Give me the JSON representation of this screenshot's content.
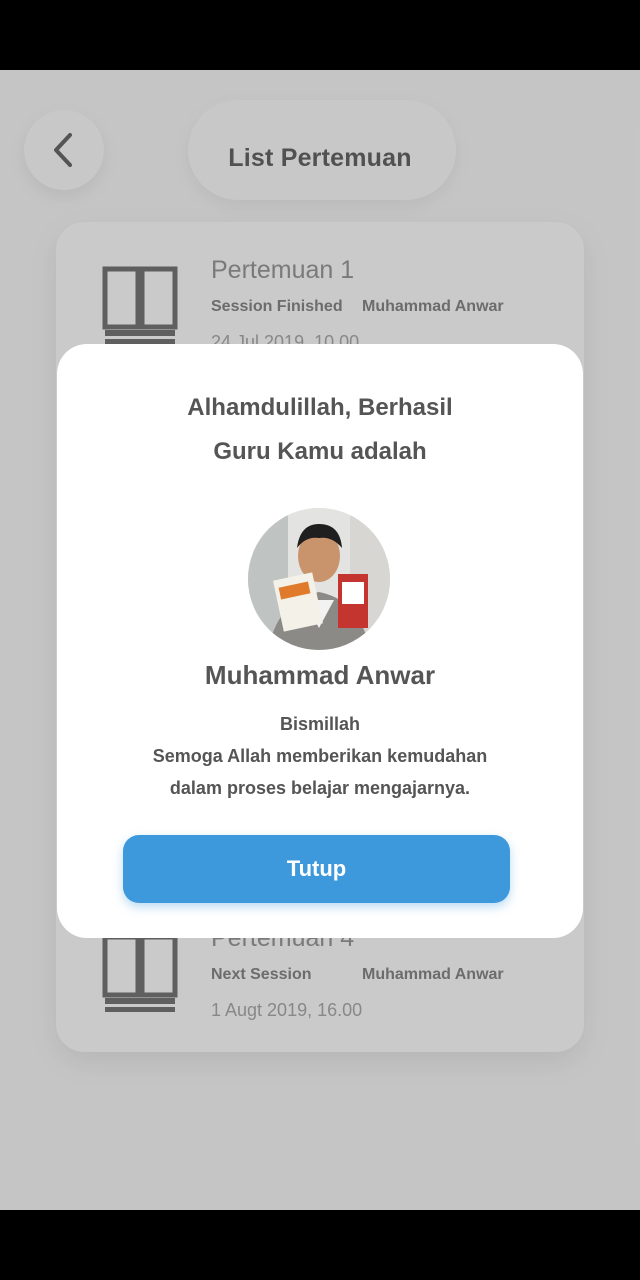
{
  "header": {
    "title": "List Pertemuan"
  },
  "meetings": [
    {
      "title": "Pertemuan 1",
      "status": "Session Finished",
      "teacher": "Muhammad Anwar",
      "date": "24 Jul 2019, 10.00"
    },
    {
      "title": "Pertemuan 4",
      "status": "Next Session",
      "teacher": "Muhammad Anwar",
      "date": "1 Augt 2019, 16.00"
    }
  ],
  "dialog": {
    "line1": "Alhamdulillah, Berhasil",
    "line2": "Guru Kamu adalah",
    "teacher_name": "Muhammad Anwar",
    "message_line1": "Bismillah",
    "message_line2": "Semoga Allah memberikan kemudahan",
    "message_line3": "dalam proses belajar mengajarnya.",
    "close_label": "Tutup"
  },
  "icons": {
    "back": "chevron-left-icon",
    "meeting": "book-icon"
  },
  "colors": {
    "accent": "#3d99db",
    "overlay": "rgba(0,0,0,0.2)"
  }
}
